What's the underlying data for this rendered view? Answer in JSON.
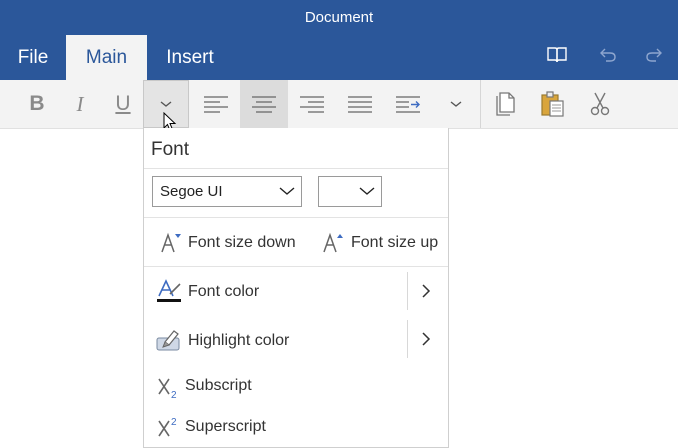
{
  "window": {
    "title": "Document"
  },
  "tabs": [
    {
      "label": "File",
      "active": false
    },
    {
      "label": "Main",
      "active": true
    },
    {
      "label": "Insert",
      "active": false
    }
  ],
  "title_icons": [
    "reading-view-icon",
    "undo-icon",
    "redo-icon"
  ],
  "ribbon": {
    "bold_label": "B",
    "italic_label": "I",
    "underline_label": "U",
    "icons": [
      "bold-icon",
      "italic-icon",
      "underline-icon",
      "font-options-chevron-icon",
      "align-left-icon",
      "align-center-icon",
      "align-right-icon",
      "justify-icon",
      "indent-icon",
      "more-paragraph-chevron-icon",
      "copy-icon",
      "paste-icon",
      "cut-icon"
    ],
    "selected": "align-center"
  },
  "font_panel": {
    "title": "Font",
    "font_family": "Segoe UI",
    "font_size": "",
    "size_down_label": "Font size down",
    "size_up_label": "Font size up",
    "font_color_label": "Font color",
    "highlight_color_label": "Highlight color",
    "subscript_label": "Subscript",
    "superscript_label": "Superscript"
  },
  "colors": {
    "brand": "#2b579a",
    "accent": "#3e6cc2",
    "ribbon_bg": "#f3f3f3"
  }
}
